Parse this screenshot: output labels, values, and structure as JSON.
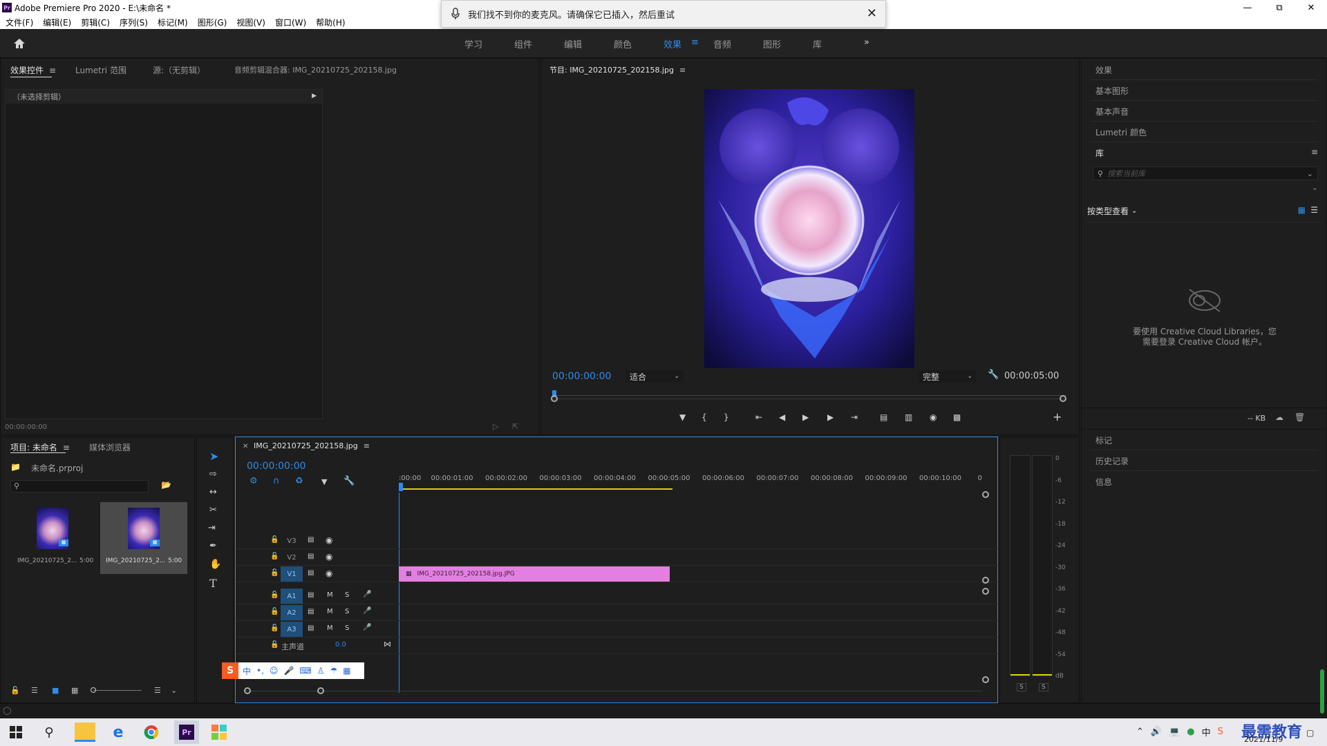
{
  "window": {
    "title": "Adobe Premiere Pro 2020 - E:\\未命名 *",
    "app_icon": "Pr"
  },
  "menu": [
    "文件(F)",
    "编辑(E)",
    "剪辑(C)",
    "序列(S)",
    "标记(M)",
    "图形(G)",
    "视图(V)",
    "窗口(W)",
    "帮助(H)"
  ],
  "notification": {
    "text": "我们找不到你的麦克风。请确保它已插入，然后重试",
    "icon": "microphone-icon"
  },
  "workspaces": [
    "学习",
    "组件",
    "编辑",
    "颜色",
    "效果",
    "音频",
    "图形",
    "库"
  ],
  "active_workspace": "效果",
  "source_panel": {
    "tabs": [
      "效果控件",
      "Lumetri 范围",
      "源:（无剪辑）",
      "音频剪辑混合器: IMG_20210725_202158.jpg"
    ],
    "no_clip_text": "（未选择剪辑）",
    "timecode": "00:00:00:00"
  },
  "program_monitor": {
    "tab": "节目: IMG_20210725_202158.jpg",
    "timecode": "00:00:00:00",
    "fit": "适合",
    "quality": "完整",
    "duration": "00:00:05:00"
  },
  "right_panel": {
    "items_top": [
      "效果",
      "基本图形",
      "基本声音",
      "Lumetri 颜色",
      "库"
    ],
    "search_placeholder": "搜索当前库",
    "view_by": "按类型查看",
    "cc_message_line1": "要使用 Creative Cloud Libraries，您",
    "cc_message_line2": "需要登录 Creative Cloud 帐户。",
    "kb": "-- KB",
    "items_bottom": [
      "标记",
      "历史记录",
      "信息"
    ]
  },
  "project_panel": {
    "tabs": [
      "项目: 未命名",
      "媒体浏览器"
    ],
    "project_file": "未命名.prproj",
    "items": [
      {
        "name": "IMG_20210725_2...",
        "duration": "5:00"
      },
      {
        "name": "IMG_20210725_2...",
        "duration": "5:00"
      }
    ]
  },
  "timeline": {
    "tab": "IMG_20210725_202158.jpg",
    "timecode": "00:00:00:00",
    "ruler": [
      ":00:00",
      "00:00:01:00",
      "00:00:02:00",
      "00:00:03:00",
      "00:00:04:00",
      "00:00:05:00",
      "00:00:06:00",
      "00:00:07:00",
      "00:00:08:00",
      "00:00:09:00",
      "00:00:10:00",
      "0"
    ],
    "video_tracks": [
      "V3",
      "V2",
      "V1"
    ],
    "audio_tracks": [
      "A1",
      "A2",
      "A3"
    ],
    "master_label": "主声道",
    "master_value": "0.0",
    "clip_name": "IMG_20210725_202158.jpg.JPG",
    "clip_color": "#e37fe0"
  },
  "meter": {
    "ticks": [
      "0",
      "-6",
      "-12",
      "-18",
      "-24",
      "-30",
      "-36",
      "-42",
      "-48",
      "-54",
      "dB"
    ],
    "solo": [
      "S",
      "S"
    ]
  },
  "taskbar": {
    "date": "2021/11/9",
    "watermark": "最需教育"
  },
  "colors": {
    "accent_blue": "#2d8ceb",
    "clip_pink": "#e37fe0",
    "panel_bg": "#1e1e1e"
  }
}
